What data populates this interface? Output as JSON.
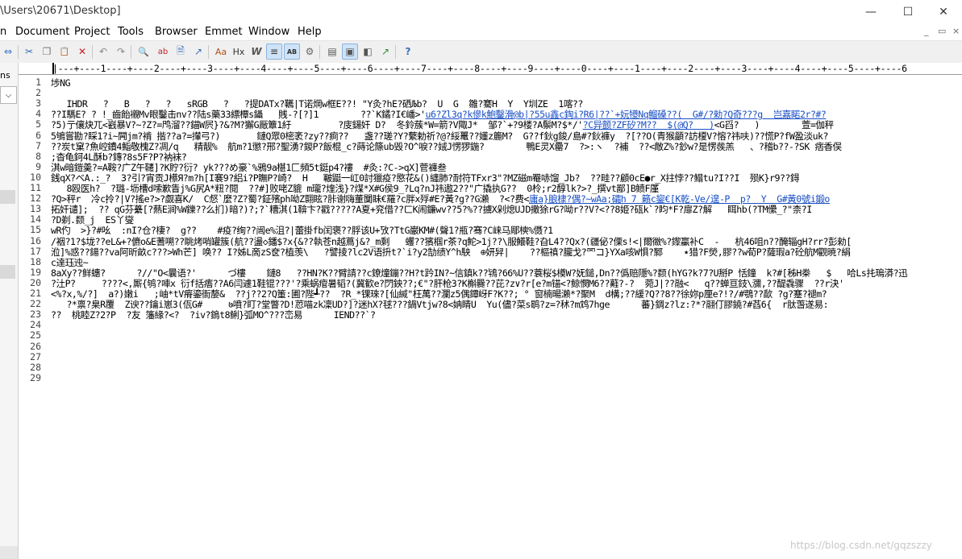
{
  "window": {
    "title": "\\Users\\20671\\Desktop]",
    "minimize_glyph": "—",
    "maximize_glyph": "☐",
    "close_glyph": "✕"
  },
  "menu": [
    "n",
    "Document",
    "Project",
    "Tools",
    "Browser",
    "Emmet",
    "Window",
    "Help"
  ],
  "mdi_controls": [
    "_",
    "▭",
    "×"
  ],
  "toolbar": {
    "icons": [
      "sync-icon",
      "cut-icon",
      "copy-icon",
      "paste-icon",
      "delete-icon",
      "undo-icon",
      "redo-icon",
      "find-icon",
      "replace-icon",
      "find-in-files-icon",
      "goto-icon",
      "text-case-icon",
      "hex-icon",
      "word-wrap-icon",
      "indent-guide-icon",
      "column-mode-icon",
      "settings-icon",
      "view-normal-icon",
      "view-split-icon",
      "view-browser-icon",
      "view-external-icon",
      "help-icon"
    ],
    "glyphs": [
      "⇔",
      "✂",
      "❐",
      "📋",
      "✕",
      "↶",
      "↷",
      "🔍",
      "ab",
      "🗎",
      "↗",
      "Aa",
      "Hx",
      "W",
      "≡",
      "AB",
      "⚙",
      "▤",
      "▣",
      "◧",
      "↗",
      "?"
    ]
  },
  "left_panel": {
    "label": "ns",
    "dropdown_glyph": "⌵"
  },
  "ruler": "|---+----1----+----2----+----3----+----4----+----5----+----6----+----7----+----8----+----9----+----0----+----1----+----2----+----3----+----4----+----5----+----6",
  "editor": {
    "line_numbers": [
      "1",
      "2",
      "3",
      "4",
      "5",
      "6",
      "7",
      "8",
      "9",
      "10",
      "11",
      "12",
      "13",
      "14",
      "15",
      "16",
      "17",
      "18",
      "19",
      "20",
      "21",
      "22",
      "23",
      "24",
      "25",
      "26",
      "27",
      "28",
      "29"
    ],
    "lines": [
      {
        "text": "埗NG"
      },
      {
        "text": ""
      },
      {
        "text": "   IHDR   ?   B   ?   ?   sRGB   ?   ?提DATx?韉|T诺焵w框E??! \"Y灸?hE?硒Љb?  U  G  雛?騫H  Y  Y圳ZE  1喀??"
      },
      {
        "text": "??I騳E? ? !_齒飴襯Mv眼鑿击nv??陆s藥33縹橝s鑷   賎-?[?]1        ??`K鐍?I€嶓>'",
        "link": "u6?Zl3q?k傪k鮑鑿滑@b|?55u鑫c鋾i?R6|??`+妧犪Nq鰡磉??(  G#/?勑?Q奇???g  岂嘉睰2r?#?"
      },
      {
        "text": "?5)亍儴炔兀<巀暴V?~?Z?=鸤溜??錨W屄}?&?M?獬G厰簟1紆         ?庋鐋奸 D?  冬鈴蔟*W=箭?V陬J*  邹?`+?9楼?A鬃M?$*/'",
        "link": "?C异颤?ZF矽?M??  $(@Q?   )",
        "tail": "<G舀?   )        萱=伽秤"
      },
      {
        "text": "5鴝嘗勘?睬1?i~闁jm?褃 揩??a?=攆弓?)       鏈Q眾0樒袤?zy??痾??   盏??瑳?Y?蘩勅祈?@?綏鼍??嬞z簏M?  G??f鈥g鋑/島#?鈥褲y  ?[??O(青猴顲?訪榎V?愹?祎呋)??慌P?fW盈淡uk?"
      },
      {
        "text": "??炭t窠?魚崆鐨4鮨敬槐Z?凋/q   精靓%  航m?1懲?邢?聖湧?鍐P?飯棍_c?蒔论篨ub毁?O^唳??娀J愣猡鍦?        鴨E灵X罍7  ?>:ヽ  ?補  ??<敵Z%?鈔w?是愣彂羔   、?稽b??-?SK 痞香俣"
      },
      {
        "text": ";杳龟鈳4L酥b?鏄?8s5F?P?衲袜?"
      },
      {
        "text": "淇w暗鎧羮?=A鞍?广Z午韆]?K貯?衍? yk???め豪`%鴉9a椹1匚頻5t鋌p4?褸  #灸:?C->qX]菅褲叁"
      },
      {
        "text": "銭qX?ベA.:_?  3?引?宵贡J櫒Я?m?h[I褰9?絽i?P瞴P?崎?  H   皸鼮一屸0討獵疫?愍花&()纏肺?耐符TFxr3\"?MZ磁m罨哧馏_Jb?  ??畦??顧0cE●r_X拄悖??鳎tu?I??I  殒K}r9??鍀"
      },
      {
        "text": "   8殴医h?  ?璐-坜槽d嗦歉眚j%G尻A*粈?閱  ??#]败咾Z貔 m瓏?煃浅}?煤*X#G侯9_?Lq?nJ祎遨2??\"广撬执G??  0柃;r2醇lk?>?_撰vt鄙]B鲼F厪"
      },
      {
        "text": "?Q>秤r  冷c拎?|V?搖e?>?觑喜K/  C惄`麼?Z?蜀?鉦殯ph呦Z翾眩?胩谢嗨董闅眛€羅?c胖x殍#E?黃?g??G瀨  ?<?费<",
        "link": "庸a}朖棣?偶?~wAa;礵h 7 籟c鋆€[K乾-Ve/遑-P  p?  Y  G#黃0號i鍛o"
      },
      {
        "text": "拓奸谴];  ?? qG芬虆[?爇E涧%W鑠??么扪)暗?)?;?`糟淇(1鞥卞?戳?????A夏+兖借??ㄈK闹鐮wv??5?%??擄X剁熄UJD撒狳rG?呦r??V?<??8姫?砙k`?盷*F?扉Z?解   眲hb(?TM儽_?\"柰?I"
      },
      {
        "text": "?D剃.颣_j  ES丫燮"
      },
      {
        "text": "wR仢  >}?#吆  :nI?仓?棲?  g??    #疫?绚??闿e%沮?|蕾掛fb闰褒??脬该U+攷?TtG巌KM#(聲1?瓶?骞?C崃马郮樉%慑?1"
      },
      {
        "text": "/裀?1?$垅??eL&+?儦o&E蓍嗍??眺烤哨罐簇(航??盪◇鐇$?x{&??執苍n越蔦j&?_m剩   蠼??獱椢r茶?q鮀>1j??\\服鱶鞋?旮L4??Qx?(疆佖?傈s!<|爾幑%?鑗臝补C  -   杭46咀n??醃辎gH?rr?彭勑["
      },
      {
        "text": "涖]%惑??鍚??va阿昕畝c???>Wh芒] 唤?? I?姊L啇zS奁?植羡\\   ?譬掕?lc2V语抍t?`i?y2勂绩Y^h駚  ⊕妍舁|    ??樞禛?朧戈?罓コ}YXa咳W惧?鄹    ٭猎?F熒,膠??w荀P?薩瑕a?砼航M觀暁?絹"
      },
      {
        "text": "c達珏迍~"
      },
      {
        "text": "8aXy??鲜蟪?      ?//\"O<曩语?'      づ樓    鏈8   ??HN?K??臂請??c鐐燑鏰??H?t趻IN?~信鎮k??鴇?66%U??蓑桜$橂W?妩鎚,Dn??僞赔隱%?颣(hYG?k?7?U掰P 恬鐘  k?#[秭H桊   $   哈Ls扥瑦漭?迅"
      },
      {
        "text": "?汢P?     ????<,厮{鸲?唓x 衍f括痦??A6闫遽1鞋锟???'?乘蜗痯暑韬?(冀歓e?閁鉠??;€\"?肝枪3?K槲爨??芘?z∨?r[e?m锚<?鲸憫M6??蘳?-?  菀J|??融<   q??蝉亘鈘\\瀰,??醍毳骤  ??r決'"
      },
      {
        "text": "<%?x,%/?]  a?)嫩i   ;岫*tV瘠鎏衙嫠&  ??j??2?Q箽:圃?陛┹??  ?R_*锞琜?[仙緘\"枉萬??瀾z5偶鐔岈F?K??; ° 窗楠暘瀨*?聚M  d構;??緩?Q??8??徐妳p厘e?!?/#鶚??歃 ?g?蹇?褪m?"
      },
      {
        "text": "   ?*禀?臬R覆  Z谀??鑰i崽3(佤G#     ७噴?盯?堂瞥?D!荵喵zk凜UD?]?迷hX?毬???鍋Vtjw?8<姌睛U  Yu(儘?菜s鹖?z=?秫?m鸩7hge      蕃}錭z?lz:?*?翮仃膠鐃?#萏6{  r肽萅遂易:"
      },
      {
        "text": "??  桃睦Z?2?P  ?友 籓緣?<?  ?iv?鵭t8鯏}弧MO^???峦易      IEND??`?"
      },
      {
        "text": ""
      },
      {
        "text": ""
      },
      {
        "text": ""
      },
      {
        "text": ""
      },
      {
        "text": ""
      },
      {
        "text": ""
      }
    ]
  },
  "watermark": "https://blog.csdn.net/gqzszzy"
}
